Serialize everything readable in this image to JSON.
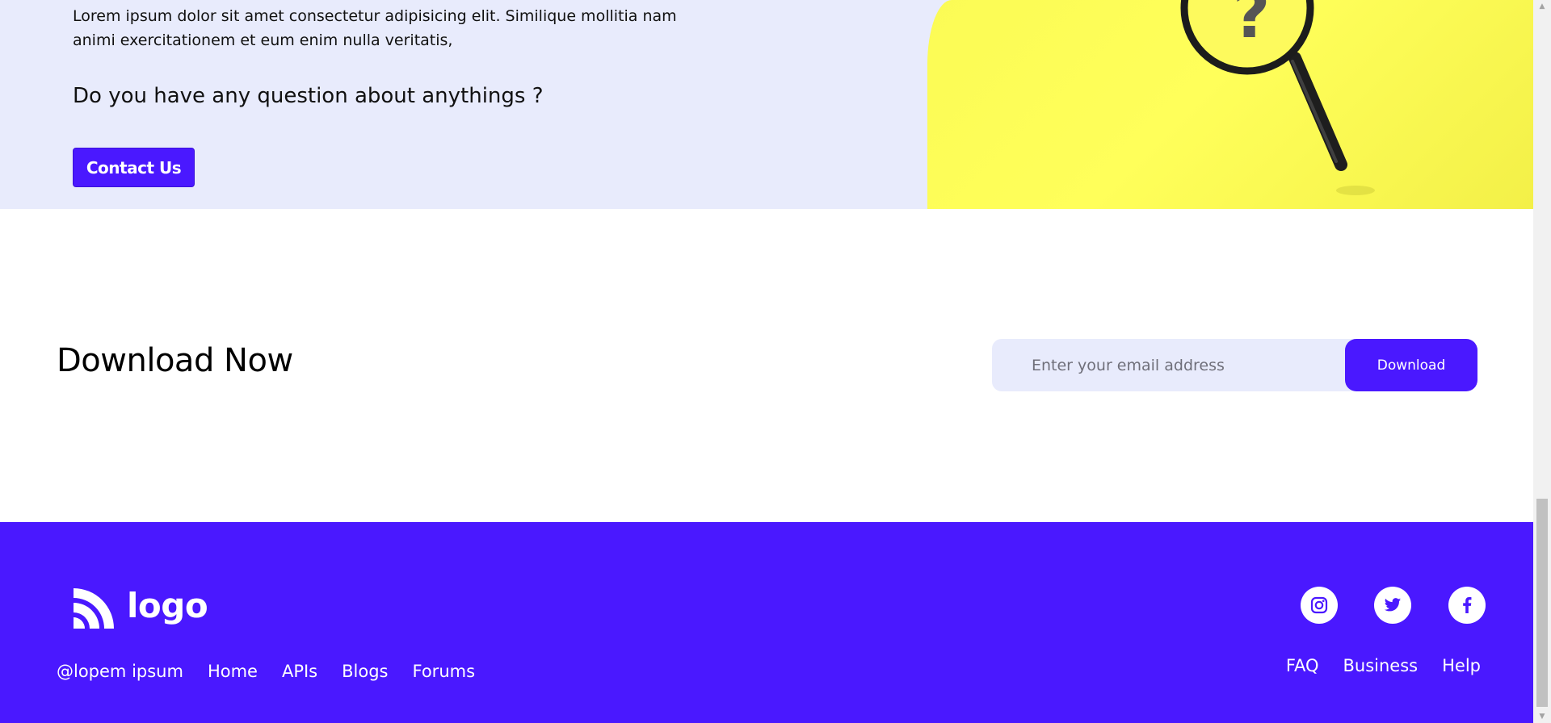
{
  "faq": {
    "body_text": "Lorem ipsum dolor sit amet consectetur adipisicing elit. Similique mollitia nam animi exercitationem et eum enim nulla veritatis,",
    "question": "Do you have any question about anythings ?",
    "contact_label": "Contact Us",
    "image_icon": "magnifying-glass-question-icon"
  },
  "download": {
    "title": "Download Now",
    "email_placeholder": "Enter your email address",
    "email_value": "",
    "button_label": "Download"
  },
  "footer": {
    "logo_text": "logo",
    "logo_icon": "signal-arcs-icon",
    "copyright": "@lopem ipsum",
    "left_links": [
      "Home",
      "APIs",
      "Blogs",
      "Forums"
    ],
    "right_links": [
      "FAQ",
      "Business",
      "Help"
    ],
    "social": [
      "instagram-icon",
      "twitter-icon",
      "facebook-icon"
    ]
  },
  "colors": {
    "accent": "#4a18ff",
    "band": "#e8ebfc",
    "yellow": "#ffff5a"
  }
}
